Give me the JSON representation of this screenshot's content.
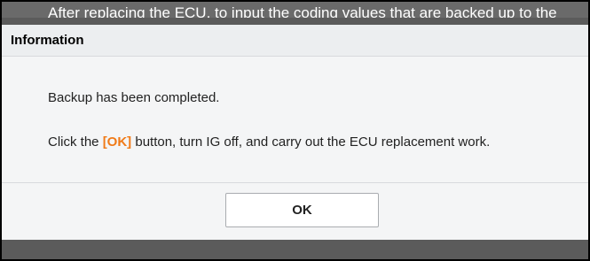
{
  "background": {
    "instruction_text": "After replacing the ECU, to input the coding values that are backed up to the"
  },
  "dialog": {
    "title": "Information",
    "message_line1": "Backup has been completed.",
    "message_line2_before": "Click the ",
    "message_line2_highlight": "[OK]",
    "message_line2_after": " button, turn IG off, and carry out the ECU replacement work.",
    "ok_label": "OK"
  },
  "colors": {
    "highlight": "#f07a17",
    "overlay": "#5b5b5b",
    "dialog_bg": "#f4f5f6"
  }
}
